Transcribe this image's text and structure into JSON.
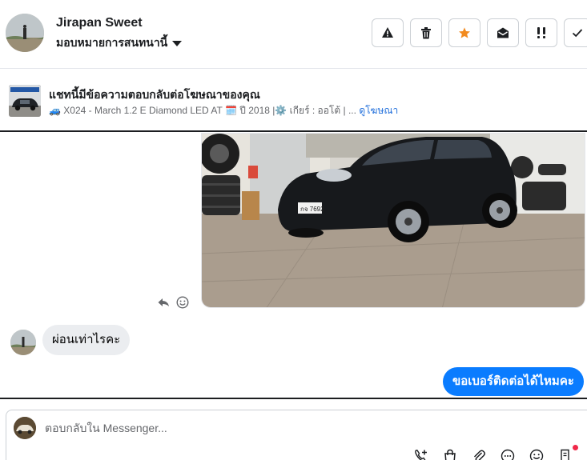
{
  "header": {
    "user_name": "Jirapan Sweet",
    "assign_label": "มอบหมายการสนทนานี้",
    "icons": [
      "warning-icon",
      "trash-icon",
      "star-icon",
      "mark-unread-icon",
      "follow-up-icon",
      "done-icon"
    ],
    "star_color": "#f28b1f"
  },
  "ad_reference": {
    "title": "แชทนี้มีข้อความตอบกลับต่อโฆษณาของคุณ",
    "car_emoji": "🚙",
    "model": "X024 - March 1.2 E Diamond LED AT",
    "calendar_emoji": "🗓️",
    "year": "ปี 2018 |",
    "gear_emoji": "⚙️",
    "gear": "เกียร์ : ออโต้ | ...",
    "link_label": "ดูโฆษณา",
    "link_color": "#216fdb"
  },
  "conversation": {
    "photo_icon": "car-photo",
    "incoming_message": "ผ่อนเท่าไรคะ",
    "outgoing_message": "ขอเบอร์ติดต่อได้ไหมคะ",
    "outgoing_color": "#0a7cff"
  },
  "composer": {
    "placeholder": "ตอบกลับใน Messenger...",
    "tools": [
      "add-contact-icon",
      "shopping-bag-icon",
      "attachment-icon",
      "saved-reply-icon",
      "emoji-icon",
      "receipt-icon"
    ]
  }
}
